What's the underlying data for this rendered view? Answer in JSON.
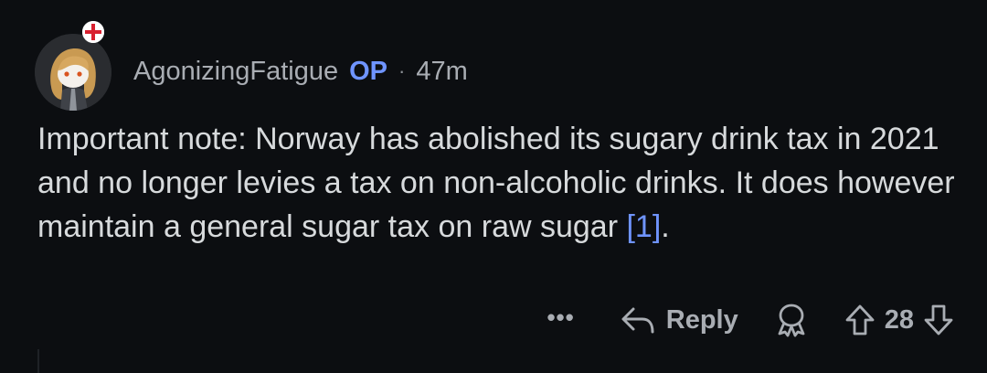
{
  "comment": {
    "username": "AgonizingFatigue",
    "op_badge": "OP",
    "separator": "·",
    "age": "47m",
    "avatar_icon": "snoo-avatar-icon",
    "flair_icon": "england-flag-icon",
    "text": "Important note: Norway has abolished its sugary drink tax in 2021 and no longer levies a tax on non-alcoholic drinks. It does however maintain a general sugar tax on raw sugar ",
    "reference_link": "[1]",
    "trailing_punct": "."
  },
  "actions": {
    "more_label": "•••",
    "reply_label": "Reply",
    "award_icon": "award-icon",
    "upvote_icon": "upvote-arrow-icon",
    "score": "28",
    "downvote_icon": "downvote-arrow-icon"
  },
  "colors": {
    "background": "#0c0e11",
    "text": "#d7dadc",
    "muted": "#a9adb3",
    "link": "#6f94ff"
  }
}
